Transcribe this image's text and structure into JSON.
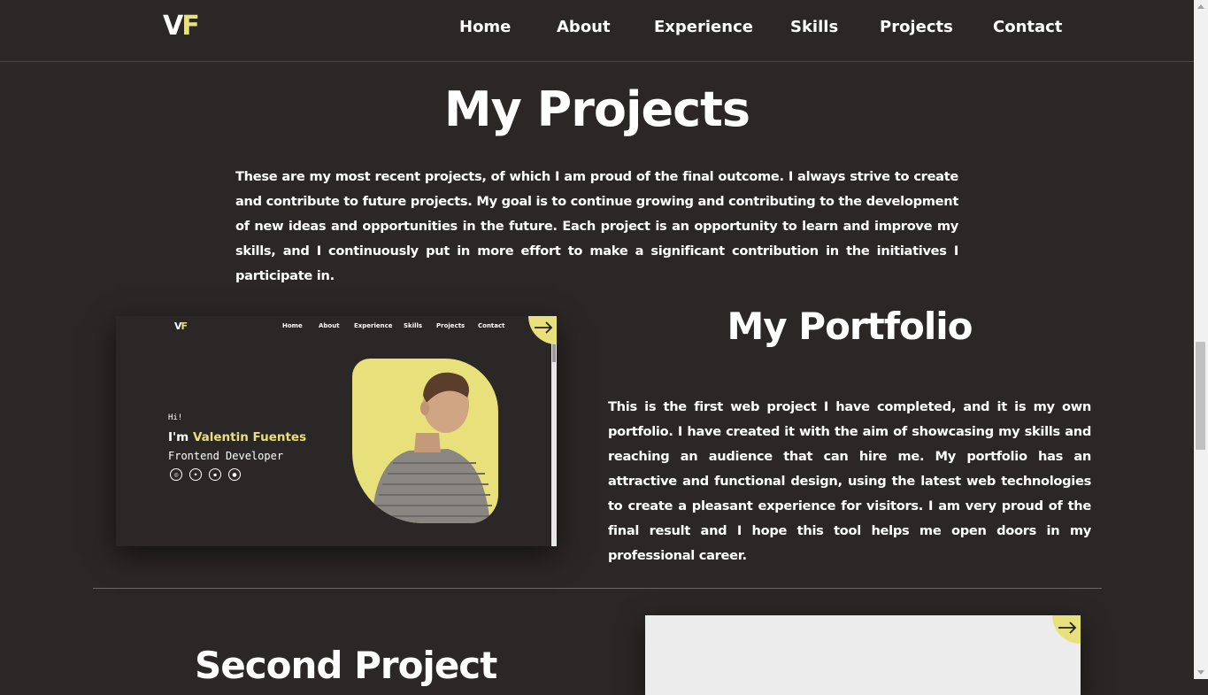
{
  "header": {
    "logo": {
      "v": "V",
      "f": "F"
    },
    "nav": [
      "Home",
      "About",
      "Experience",
      "Skills",
      "Projects",
      "Contact"
    ]
  },
  "section": {
    "title": "My Projects",
    "intro": "These are my most recent projects, of which I am proud of the final outcome. I always strive to create and contribute to future projects. My goal is to continue growing and contributing to the development of new ideas and opportunities in the future. Each project is an opportunity to learn and improve my skills, and I continuously put in more effort to make a significant contribution in the initiatives I participate in."
  },
  "projects": [
    {
      "title": "My Portfolio",
      "description": "This is the first web project I have completed, and it is my own portfolio. I have created it with the aim of showcasing my skills and reaching an audience that can hire me. My portfolio has an attractive and functional design, using the latest web technologies to create a pleasant experience for visitors. I am very proud of the final result and I hope this tool helps me open doors in my professional career.",
      "preview": {
        "logo": {
          "v": "V",
          "f": "F"
        },
        "nav": [
          "Home",
          "About",
          "Experience",
          "Skills",
          "Projects",
          "Contact"
        ],
        "greeting": "Hi!",
        "name_prefix": "I'm ",
        "name": "Valentin Fuentes",
        "role": "Frontend Developer",
        "social_icons": [
          "instagram-icon",
          "twitter-icon",
          "linkedin-icon",
          "github-icon"
        ]
      }
    },
    {
      "title": "Second Project"
    }
  ],
  "colors": {
    "background": "#2b2726",
    "accent": "#e8e07a",
    "text": "#ffffff"
  }
}
